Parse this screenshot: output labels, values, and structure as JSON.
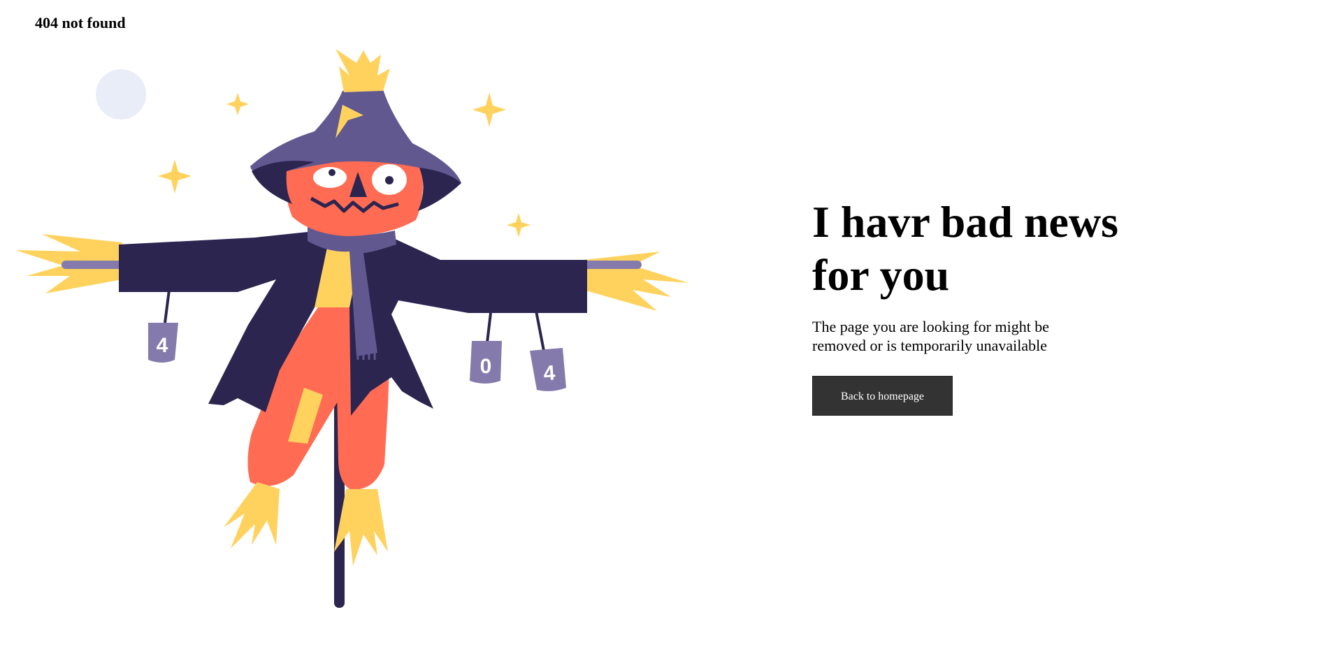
{
  "site": {
    "label": "404 not found"
  },
  "illustration": {
    "cans": [
      "4",
      "0",
      "4"
    ]
  },
  "main": {
    "headline": "I havr bad news for you",
    "message": "The page you are looking for might be removed or is temporarily unavailable",
    "button_label": "Back to homepage"
  },
  "colors": {
    "button_bg": "#333333",
    "coat": "#2b2550",
    "hat": "#615890",
    "pumpkin": "#ff6b53",
    "straw": "#ffd25e",
    "can": "#847aab",
    "moon": "#e9edf7"
  }
}
